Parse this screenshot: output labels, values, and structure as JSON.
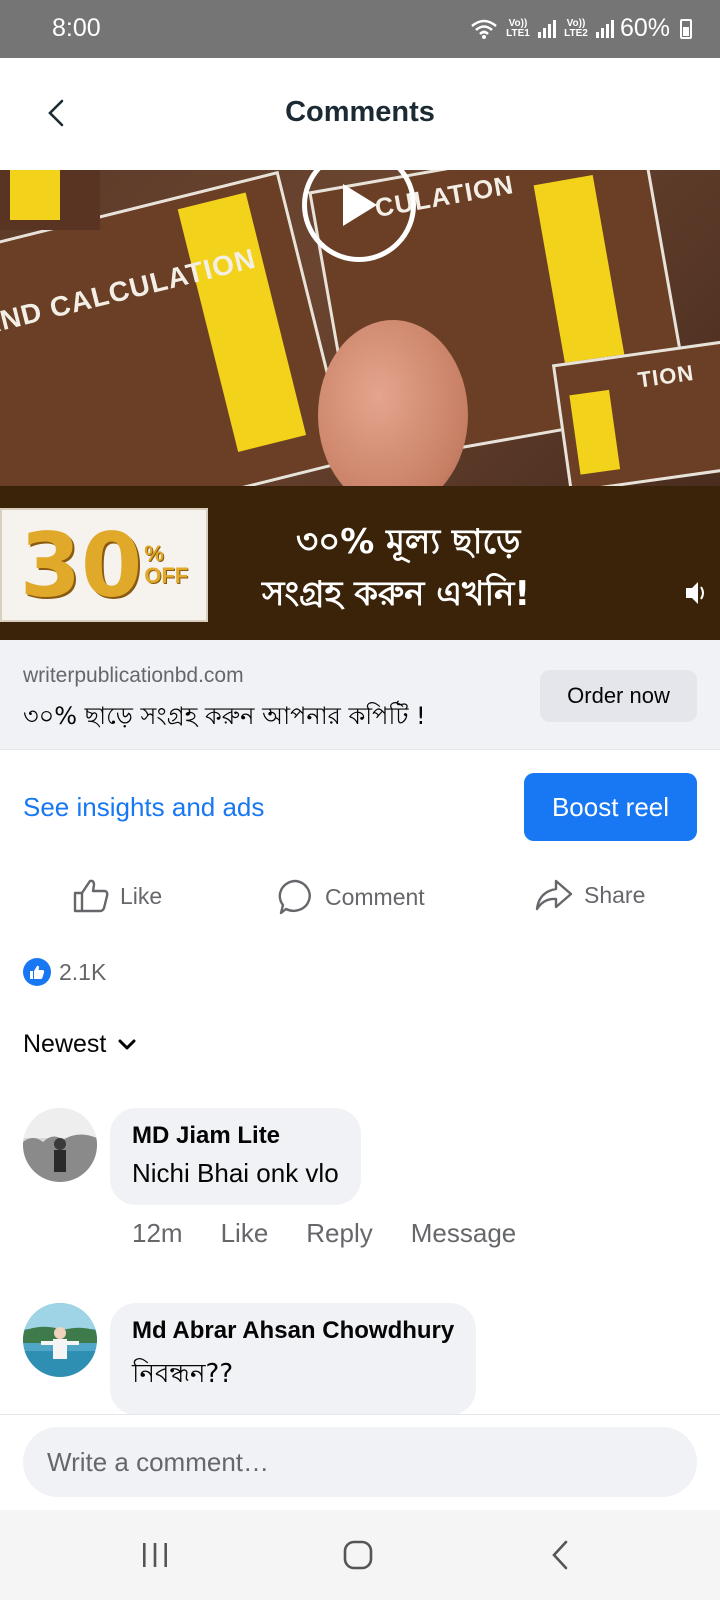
{
  "status_bar": {
    "time": "8:00",
    "sim1_label": "Vo)) LTE1",
    "sim2_label": "Vo)) LTE2",
    "battery": "60%"
  },
  "header": {
    "title": "Comments"
  },
  "media": {
    "book_title_1": "AND CALCULATION",
    "book_title_2": "CULATION",
    "book_title_3": "TION",
    "discount_number": "30",
    "discount_suffix_1": "%",
    "discount_suffix_2": "OFF",
    "banner_line1": "৩০% মূল্য ছাড়ে",
    "banner_line2": "সংগ্রহ করুন এখনি!"
  },
  "ad": {
    "domain": "writerpublicationbd.com",
    "description": "৩০% ছাড়ে সংগ্রহ করুন আপনার কপিটি !",
    "cta_label": "Order now"
  },
  "promo": {
    "insights_label": "See insights and ads",
    "boost_label": "Boost reel"
  },
  "actions": {
    "like": "Like",
    "comment": "Comment",
    "share": "Share"
  },
  "reactions": {
    "count": "2.1K"
  },
  "sort": {
    "label": "Newest"
  },
  "comments": [
    {
      "name": "MD Jiam Lite",
      "text": "Nichi Bhai onk vlo",
      "time": "12m",
      "like": "Like",
      "reply": "Reply",
      "message": "Message"
    },
    {
      "name": "Md Abrar Ahsan Chowdhury",
      "text": "নিবন্ধন??"
    }
  ],
  "composer": {
    "placeholder": "Write a comment…"
  },
  "colors": {
    "accent": "#1877f2",
    "status_bar": "#757575",
    "bubble": "#f0f2f5",
    "secondary_text": "#65676b"
  }
}
